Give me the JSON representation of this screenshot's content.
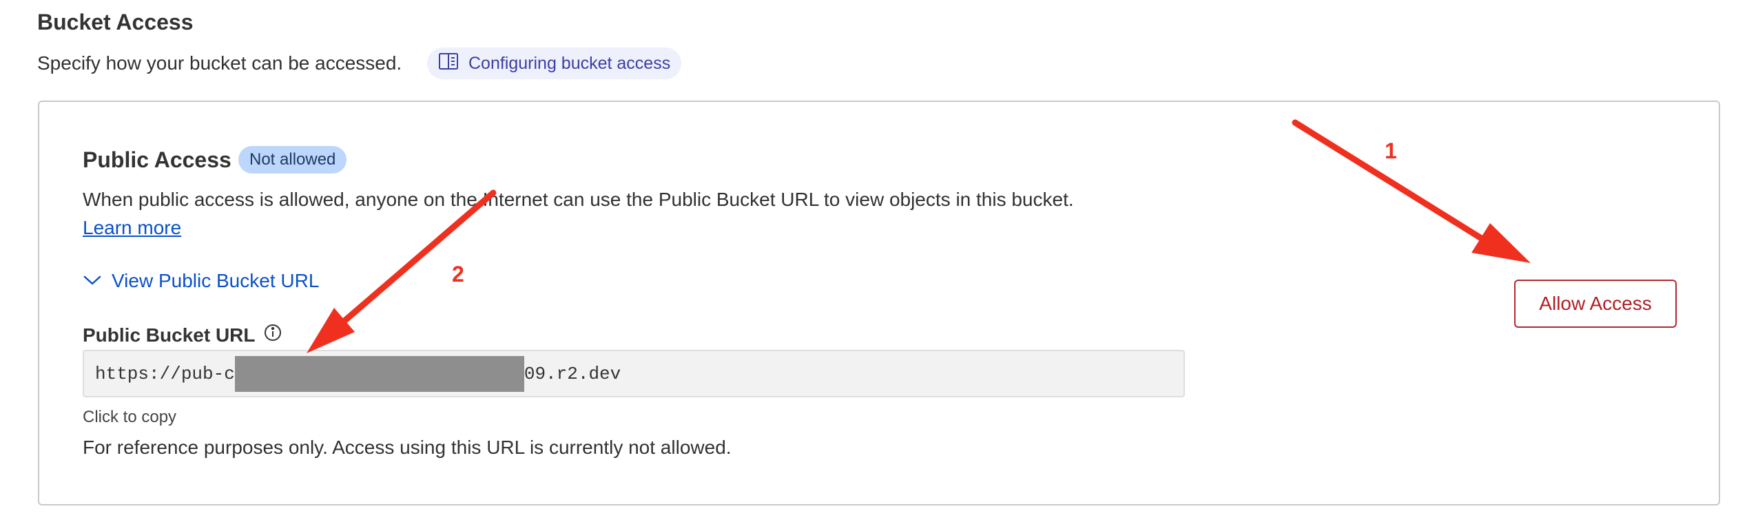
{
  "section": {
    "title": "Bucket Access",
    "description": "Specify how your bucket can be accessed.",
    "doc_link": {
      "label": "Configuring bucket access",
      "icon": "book-icon"
    }
  },
  "public_access": {
    "title": "Public Access",
    "status_badge": "Not allowed",
    "description": "When public access is allowed, anyone on the Internet can use the Public Bucket URL to view objects in this bucket.",
    "learn_more": "Learn more",
    "view_url_toggle": "View Public Bucket URL",
    "url_label": "Public Bucket URL",
    "url_prefix": "https://pub-c",
    "url_suffix": "09.r2.dev",
    "click_to_copy": "Click to copy",
    "reference_note": "For reference purposes only. Access using this URL is currently not allowed.",
    "allow_button": "Allow Access"
  },
  "annotations": {
    "step_1": "1",
    "step_2": "2",
    "arrow_color": "#f0301f"
  },
  "colors": {
    "link": "#0a51c9",
    "badge_bg": "#bcd7fb",
    "danger": "#b01e24",
    "doc_pill_bg": "#eef0fb"
  }
}
